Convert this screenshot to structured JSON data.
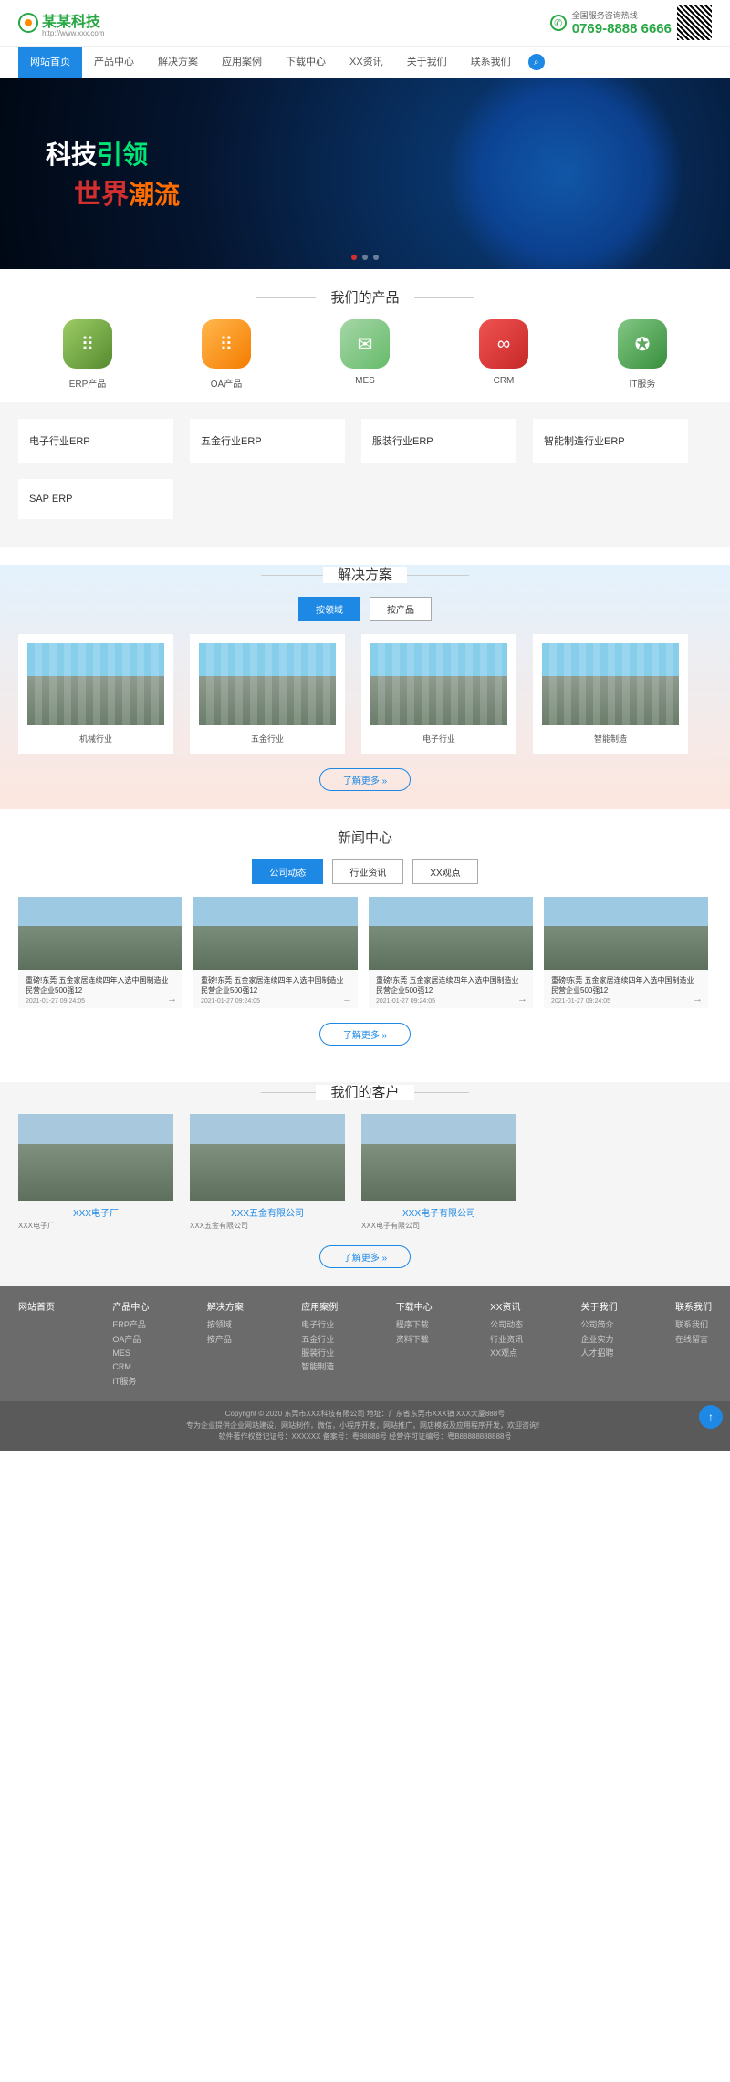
{
  "header": {
    "logo_text": "某某科技",
    "logo_sub": "http://www.xxx.com",
    "hotline_label": "全国服务咨询热线",
    "hotline_number": "0769-8888 6666"
  },
  "nav": {
    "items": [
      "网站首页",
      "产品中心",
      "解决方案",
      "应用案例",
      "下载中心",
      "XX资讯",
      "关于我们",
      "联系我们"
    ]
  },
  "banner": {
    "line1a": "科技",
    "line1b": "引领",
    "line2a": "世界",
    "line2b": "潮流"
  },
  "products": {
    "title": "我们的产品",
    "icons": [
      {
        "name": "ERP产品",
        "glyph": "⠿"
      },
      {
        "name": "OA产品",
        "glyph": "⠿"
      },
      {
        "name": "MES",
        "glyph": "✉"
      },
      {
        "name": "CRM",
        "glyph": "∞"
      },
      {
        "name": "IT服务",
        "glyph": "✪"
      }
    ],
    "cats": [
      "电子行业ERP",
      "五金行业ERP",
      "服装行业ERP",
      "智能制造行业ERP",
      "SAP ERP"
    ]
  },
  "solutions": {
    "title": "解决方案",
    "tabs": [
      "按领域",
      "按产品"
    ],
    "items": [
      "机械行业",
      "五金行业",
      "电子行业",
      "智能制造"
    ],
    "more": "了解更多 »"
  },
  "news": {
    "title": "新闻中心",
    "tabs": [
      "公司动态",
      "行业资讯",
      "XX观点"
    ],
    "item_title": "重磅!东莞 五金家居连续四年入选中国制造业民营企业500强12",
    "item_date": "2021-01-27 09:24:05",
    "more": "了解更多 »"
  },
  "customers": {
    "title": "我们的客户",
    "items": [
      {
        "name": "XXX电子厂",
        "sub": "XXX电子厂"
      },
      {
        "name": "XXX五金有限公司",
        "sub": "XXX五金有限公司"
      },
      {
        "name": "XXX电子有限公司",
        "sub": "XXX电子有限公司"
      }
    ],
    "more": "了解更多 »"
  },
  "footer": {
    "cols": [
      {
        "h": "网站首页",
        "links": []
      },
      {
        "h": "产品中心",
        "links": [
          "ERP产品",
          "OA产品",
          "MES",
          "CRM",
          "IT服务"
        ]
      },
      {
        "h": "解决方案",
        "links": [
          "按领域",
          "按产品"
        ]
      },
      {
        "h": "应用案例",
        "links": [
          "电子行业",
          "五金行业",
          "服装行业",
          "智能制造"
        ]
      },
      {
        "h": "下载中心",
        "links": [
          "程序下载",
          "资料下载"
        ]
      },
      {
        "h": "XX资讯",
        "links": [
          "公司动态",
          "行业资讯",
          "XX观点"
        ]
      },
      {
        "h": "关于我们",
        "links": [
          "公司简介",
          "企业实力",
          "人才招聘"
        ]
      },
      {
        "h": "联系我们",
        "links": [
          "联系我们",
          "在线留言"
        ]
      }
    ],
    "copy1": "Copyright © 2020 东莞市XXX科技有限公司  地址：广东省东莞市XXX镇 XXX大厦888号",
    "copy2": "专为企业提供企业网站建设，网站制作，微信，小程序开发，网站推广，网店模板及应用程序开发，欢迎咨询！",
    "copy3": "软件著作权登记证号：XXXXXX 备案号：粤88888号 经营许可证编号：粤B88888888888号"
  }
}
